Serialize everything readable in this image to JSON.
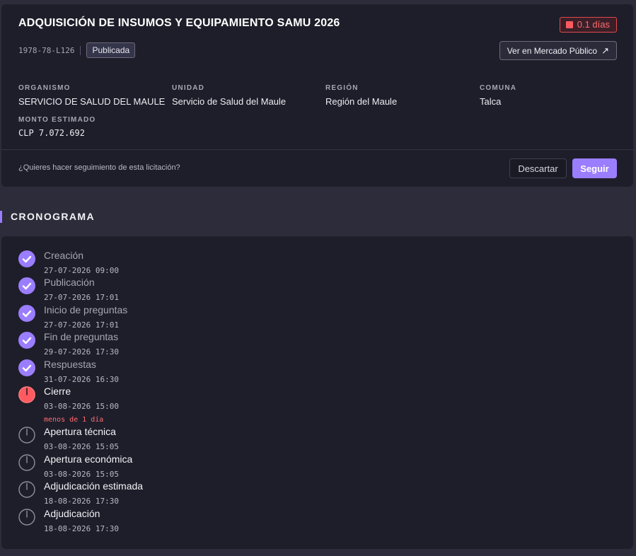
{
  "header": {
    "title": "ADQUISICIÓN DE INSUMOS Y EQUIPAMIENTO SAMU 2026",
    "days_badge": "0.1 días",
    "code": "1978-78-L126",
    "status": "Publicada",
    "external_button": "Ver en Mercado Público",
    "fields": {
      "organismo": {
        "label": "ORGANISMO",
        "value": "SERVICIO DE SALUD DEL MAULE"
      },
      "unidad": {
        "label": "UNIDAD",
        "value": "Servicio de Salud del Maule"
      },
      "region": {
        "label": "REGIÓN",
        "value": "Región del Maule"
      },
      "comuna": {
        "label": "COMUNA",
        "value": "Talca"
      },
      "monto": {
        "label": "MONTO ESTIMADO",
        "value": "CLP 7.072.692"
      }
    },
    "follow_question": "¿Quieres hacer seguimiento de esta licitación?",
    "discard_label": "Descartar",
    "follow_label": "Seguir"
  },
  "timeline": {
    "title": "CRONOGRAMA",
    "items": [
      {
        "name": "Creación",
        "date": "27-07-2026 09:00",
        "status": "done"
      },
      {
        "name": "Publicación",
        "date": "27-07-2026 17:01",
        "status": "done"
      },
      {
        "name": "Inicio de preguntas",
        "date": "27-07-2026 17:01",
        "status": "done"
      },
      {
        "name": "Fin de preguntas",
        "date": "29-07-2026 17:30",
        "status": "done"
      },
      {
        "name": "Respuestas",
        "date": "31-07-2026 16:30",
        "status": "done"
      },
      {
        "name": "Cierre",
        "date": "03-08-2026 15:00",
        "status": "current",
        "note": "menos de 1 día"
      },
      {
        "name": "Apertura técnica",
        "date": "03-08-2026 15:05",
        "status": "pending"
      },
      {
        "name": "Apertura económica",
        "date": "03-08-2026 15:05",
        "status": "pending"
      },
      {
        "name": "Adjudicación estimada",
        "date": "18-08-2026 17:30",
        "status": "pending"
      },
      {
        "name": "Adjudicación",
        "date": "18-08-2026 17:30",
        "status": "pending"
      }
    ]
  },
  "colors": {
    "accent": "#9b7dff",
    "danger": "#ff5a5f",
    "background": "#2d2c3a",
    "card": "#1e1e2a"
  },
  "icons": {
    "done": "check-circle-icon",
    "current": "clock-alert-icon",
    "pending": "clock-icon"
  }
}
